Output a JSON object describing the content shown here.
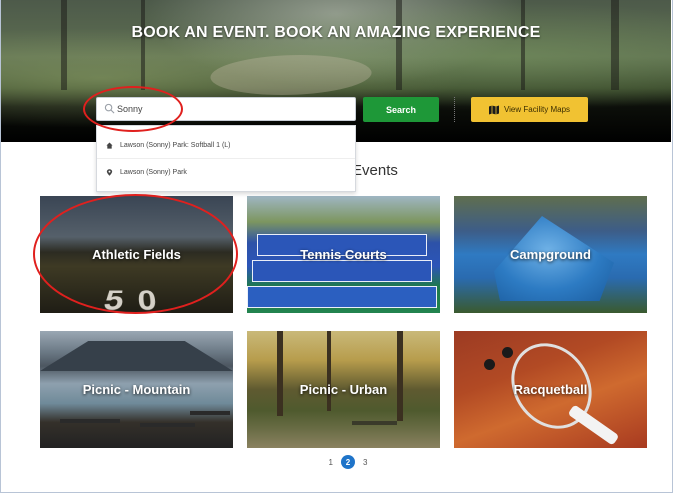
{
  "hero": {
    "title": "BOOK AN EVENT. BOOK AN AMAZING EXPERIENCE"
  },
  "search": {
    "value": "Sonny",
    "button_label": "Search",
    "maps_button_label": "View Facility Maps",
    "icon": "search-icon"
  },
  "suggestions": [
    {
      "icon": "home-icon",
      "label": "Lawson (Sonny) Park: Softball 1 (L)"
    },
    {
      "icon": "map-pin-icon",
      "label": "Lawson (Sonny) Park"
    }
  ],
  "section": {
    "title": "Events"
  },
  "tiles": [
    {
      "label": "Athletic Fields"
    },
    {
      "label": "Tennis Courts"
    },
    {
      "label": "Campground"
    },
    {
      "label": "Picnic - Mountain"
    },
    {
      "label": "Picnic - Urban"
    },
    {
      "label": "Racquetball"
    }
  ],
  "pagination": {
    "pages": [
      "1",
      "2",
      "3"
    ],
    "current": "2"
  },
  "colors": {
    "search_button": "#1e9838",
    "maps_button": "#f1c232",
    "annotation": "#e0201e",
    "active_page": "#1f74c9"
  }
}
